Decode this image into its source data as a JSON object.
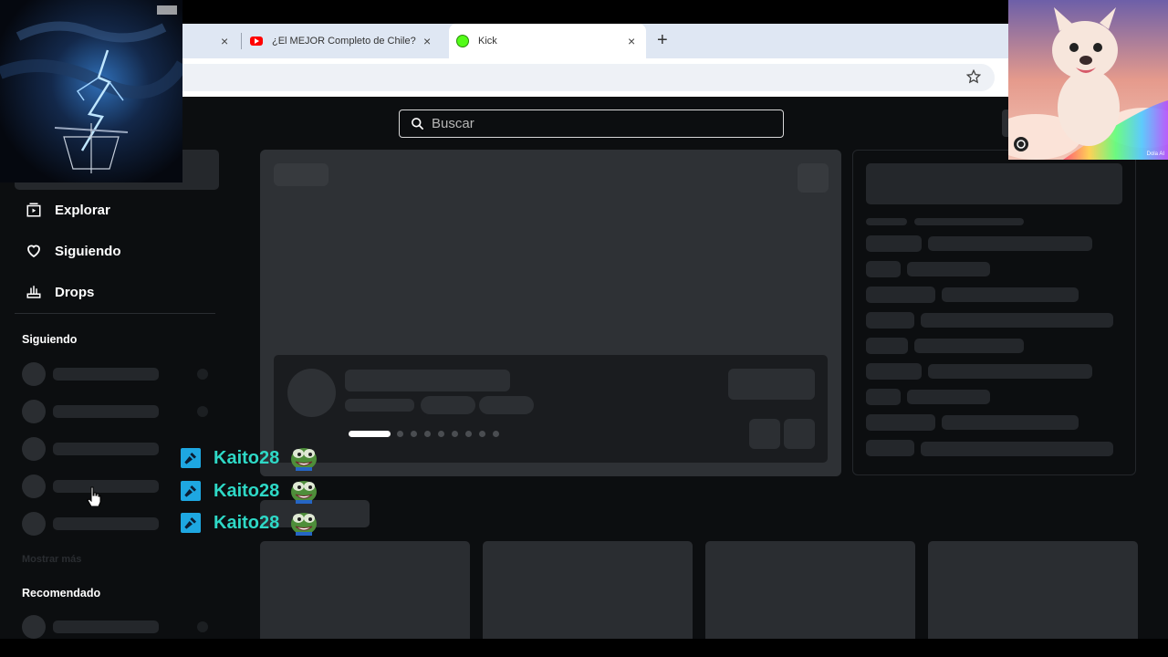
{
  "browser": {
    "tabs": [
      {
        "label": "",
        "icon": "blank",
        "active": false
      },
      {
        "label": "¿El MEJOR Completo de Chile?",
        "icon": "youtube-icon",
        "active": false
      },
      {
        "label": "Kick",
        "icon": "kick-icon",
        "active": true
      }
    ],
    "new_tab": "+",
    "close_glyph": "×"
  },
  "site": {
    "search_placeholder": "Buscar",
    "nav": [
      {
        "label": "Explorar",
        "icon": "explore-icon"
      },
      {
        "label": "Siguiendo",
        "icon": "heart-icon"
      },
      {
        "label": "Drops",
        "icon": "drops-icon"
      }
    ],
    "sidebar": {
      "following_title": "Siguiendo",
      "show_more": "Mostrar más",
      "recommended_title": "Recomendado"
    }
  },
  "chat_overlay": {
    "lines": [
      {
        "username": "Kaito28",
        "badge": "moderator-hammer-icon",
        "emote": "pepe-emote"
      },
      {
        "username": "Kaito28",
        "badge": "moderator-hammer-icon",
        "emote": "pepe-emote"
      },
      {
        "username": "Kaito28",
        "badge": "moderator-hammer-icon",
        "emote": "pepe-emote"
      }
    ]
  },
  "overlays": {
    "dog_cam_caption": "Dola AI"
  },
  "colors": {
    "page_bg": "#0c0e10",
    "skeleton": "#24272b",
    "chat_name": "#2ed8c6",
    "mod_badge": "#1ea7e1",
    "tabbar": "#dfe7f3"
  }
}
